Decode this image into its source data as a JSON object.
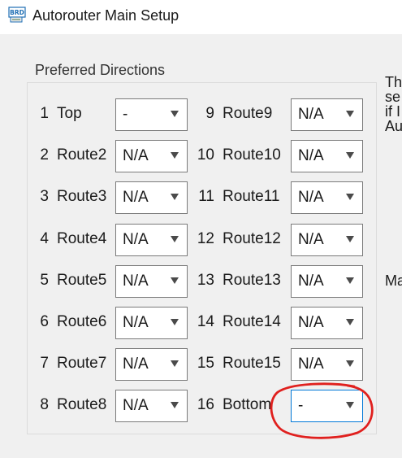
{
  "window": {
    "title": "Autorouter Main Setup",
    "icon": "brd-file-icon",
    "icon_text": "BRD"
  },
  "group": {
    "label": "Preferred Directions"
  },
  "rows_left": [
    {
      "num": "1",
      "layer": "Top",
      "value": "-"
    },
    {
      "num": "2",
      "layer": "Route2",
      "value": "N/A"
    },
    {
      "num": "3",
      "layer": "Route3",
      "value": "N/A"
    },
    {
      "num": "4",
      "layer": "Route4",
      "value": "N/A"
    },
    {
      "num": "5",
      "layer": "Route5",
      "value": "N/A"
    },
    {
      "num": "6",
      "layer": "Route6",
      "value": "N/A"
    },
    {
      "num": "7",
      "layer": "Route7",
      "value": "N/A"
    },
    {
      "num": "8",
      "layer": "Route8",
      "value": "N/A"
    }
  ],
  "rows_right": [
    {
      "num": "9",
      "layer": "Route9",
      "value": "N/A"
    },
    {
      "num": "10",
      "layer": "Route10",
      "value": "N/A"
    },
    {
      "num": "11",
      "layer": "Route11",
      "value": "N/A"
    },
    {
      "num": "12",
      "layer": "Route12",
      "value": "N/A"
    },
    {
      "num": "13",
      "layer": "Route13",
      "value": "N/A"
    },
    {
      "num": "14",
      "layer": "Route14",
      "value": "N/A"
    },
    {
      "num": "15",
      "layer": "Route15",
      "value": "N/A"
    },
    {
      "num": "16",
      "layer": "Bottom",
      "value": "-"
    }
  ],
  "side_panel": {
    "lines": [
      "Th",
      "se",
      "if I",
      "Au"
    ],
    "lower_text": "Ma"
  },
  "colors": {
    "annotation": "#e0201e",
    "focus_border": "#0078d7"
  }
}
